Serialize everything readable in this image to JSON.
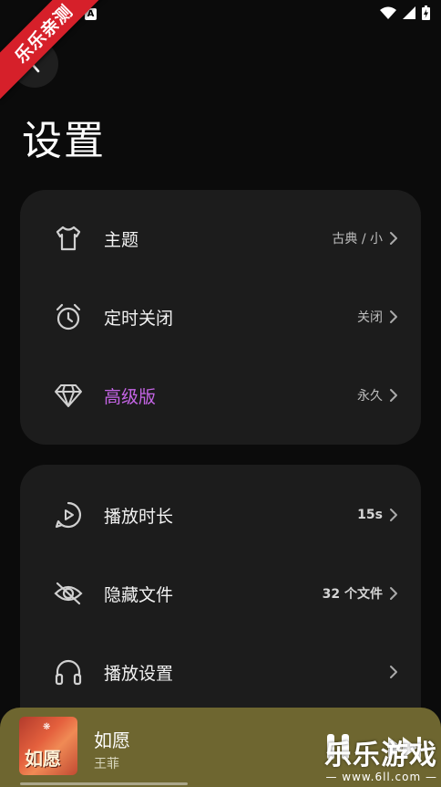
{
  "status_bar": {
    "notification_badge": "A"
  },
  "watermark_ribbon": "乐乐亲测",
  "page_title": "设置",
  "cards": [
    {
      "rows": [
        {
          "icon": "shirt-icon",
          "label": "主题",
          "value": "古典 / 小"
        },
        {
          "icon": "alarm-clock-icon",
          "label": "定时关闭",
          "value": "关闭"
        },
        {
          "icon": "diamond-icon",
          "label": "高级版",
          "value": "永久"
        }
      ]
    },
    {
      "rows": [
        {
          "icon": "play-duration-icon",
          "label": "播放时长",
          "value": "15s"
        },
        {
          "icon": "eye-off-icon",
          "label": "隐藏文件",
          "value": "32 个文件"
        },
        {
          "icon": "headphones-icon",
          "label": "播放设置",
          "value": ""
        }
      ]
    }
  ],
  "player": {
    "song_title": "如愿",
    "artist": "王菲",
    "album_art_text": "如愿",
    "progress": 0.38
  },
  "watermark": {
    "title": "乐乐游戏",
    "url": "— www.6ll.com —"
  },
  "colors": {
    "background": "#0b0b0b",
    "card": "#1c1c1c",
    "premium": "#c565e6",
    "player": "#6e6630"
  }
}
